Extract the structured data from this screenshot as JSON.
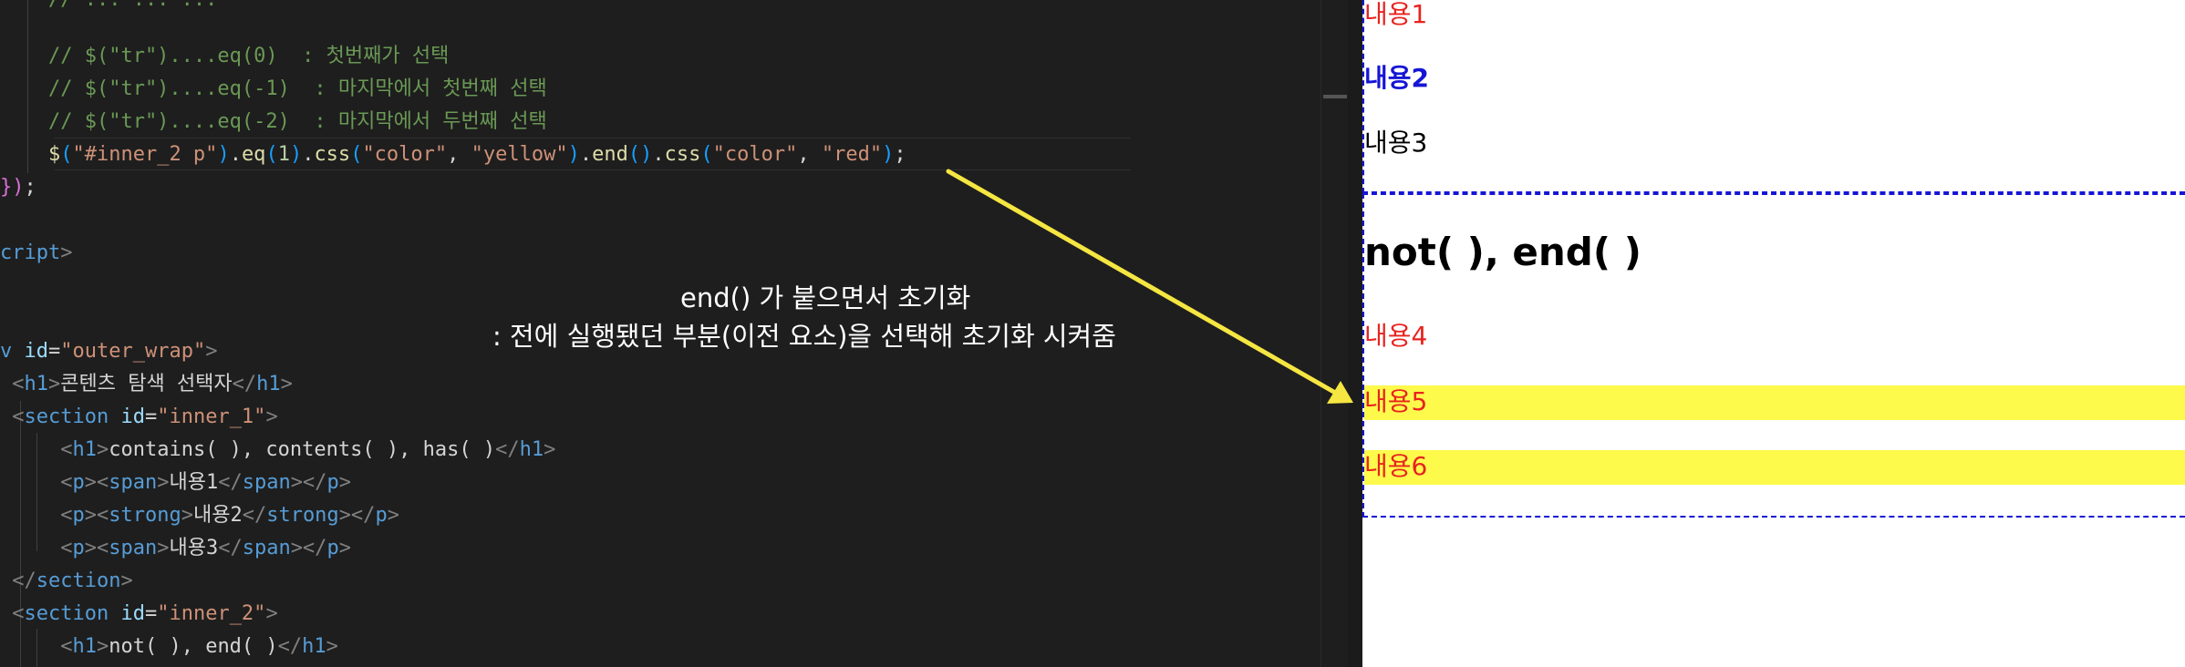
{
  "editor": {
    "lines": [
      {
        "segments": [
          {
            "t": "    // $(\"tr\")....eq(0)  : 첫번째가 선택",
            "c": "c-com"
          }
        ]
      },
      {
        "segments": [
          {
            "t": "    // $(\"tr\")....eq(-1)  : 마지막에서 첫번째 선택",
            "c": "c-com"
          }
        ]
      },
      {
        "segments": [
          {
            "t": "    // $(\"tr\")....eq(-2)  : 마지막에서 두번째 선택",
            "c": "c-com"
          }
        ]
      },
      {
        "segments": [
          {
            "t": "    $",
            "c": "c-fn"
          },
          {
            "t": "(",
            "c": "c-b2"
          },
          {
            "t": "\"#inner_2 p\"",
            "c": "c-str"
          },
          {
            "t": ")",
            "c": "c-b2"
          },
          {
            "t": ".",
            "c": "c-pun"
          },
          {
            "t": "eq",
            "c": "c-fn"
          },
          {
            "t": "(",
            "c": "c-b2"
          },
          {
            "t": "1",
            "c": "c-num"
          },
          {
            "t": ")",
            "c": "c-b2"
          },
          {
            "t": ".",
            "c": "c-pun"
          },
          {
            "t": "css",
            "c": "c-fn"
          },
          {
            "t": "(",
            "c": "c-b2"
          },
          {
            "t": "\"color\"",
            "c": "c-str"
          },
          {
            "t": ", ",
            "c": "c-pun"
          },
          {
            "t": "\"yellow\"",
            "c": "c-str"
          },
          {
            "t": ")",
            "c": "c-b2"
          },
          {
            "t": ".",
            "c": "c-pun"
          },
          {
            "t": "end",
            "c": "c-fn"
          },
          {
            "t": "()",
            "c": "c-b2"
          },
          {
            "t": ".",
            "c": "c-pun"
          },
          {
            "t": "css",
            "c": "c-fn"
          },
          {
            "t": "(",
            "c": "c-b2"
          },
          {
            "t": "\"color\"",
            "c": "c-str"
          },
          {
            "t": ", ",
            "c": "c-pun"
          },
          {
            "t": "\"red\"",
            "c": "c-str"
          },
          {
            "t": ")",
            "c": "c-b2"
          },
          {
            "t": ";",
            "c": "c-pun"
          }
        ]
      },
      {
        "segments": [
          {
            "t": "})",
            "c": "c-b1"
          },
          {
            "t": ";",
            "c": "c-pun"
          }
        ]
      },
      {
        "segments": []
      },
      {
        "segments": [
          {
            "t": "cript",
            "c": "c-tag"
          },
          {
            "t": ">",
            "c": "c-ang"
          }
        ]
      },
      {
        "segments": []
      },
      {
        "segments": []
      },
      {
        "segments": [
          {
            "t": "v ",
            "c": "c-tag"
          },
          {
            "t": "id",
            "c": "c-attr"
          },
          {
            "t": "=",
            "c": "c-pun"
          },
          {
            "t": "\"outer_wrap\"",
            "c": "c-str"
          },
          {
            "t": ">",
            "c": "c-ang"
          }
        ]
      },
      {
        "segments": [
          {
            "t": " <",
            "c": "c-ang"
          },
          {
            "t": "h1",
            "c": "c-tag"
          },
          {
            "t": ">",
            "c": "c-ang"
          },
          {
            "t": "콘텐츠 탐색 선택자",
            "c": "c-txt"
          },
          {
            "t": "</",
            "c": "c-ang"
          },
          {
            "t": "h1",
            "c": "c-tag"
          },
          {
            "t": ">",
            "c": "c-ang"
          }
        ]
      },
      {
        "segments": [
          {
            "t": " <",
            "c": "c-ang"
          },
          {
            "t": "section ",
            "c": "c-tag"
          },
          {
            "t": "id",
            "c": "c-attr"
          },
          {
            "t": "=",
            "c": "c-pun"
          },
          {
            "t": "\"inner_1\"",
            "c": "c-str"
          },
          {
            "t": ">",
            "c": "c-ang"
          }
        ]
      },
      {
        "segments": [
          {
            "t": "     <",
            "c": "c-ang"
          },
          {
            "t": "h1",
            "c": "c-tag"
          },
          {
            "t": ">",
            "c": "c-ang"
          },
          {
            "t": "contains( ), contents( ), has( )",
            "c": "c-txt"
          },
          {
            "t": "</",
            "c": "c-ang"
          },
          {
            "t": "h1",
            "c": "c-tag"
          },
          {
            "t": ">",
            "c": "c-ang"
          }
        ]
      },
      {
        "segments": [
          {
            "t": "     <",
            "c": "c-ang"
          },
          {
            "t": "p",
            "c": "c-tag"
          },
          {
            "t": "><",
            "c": "c-ang"
          },
          {
            "t": "span",
            "c": "c-tag"
          },
          {
            "t": ">",
            "c": "c-ang"
          },
          {
            "t": "내용1",
            "c": "c-txt"
          },
          {
            "t": "</",
            "c": "c-ang"
          },
          {
            "t": "span",
            "c": "c-tag"
          },
          {
            "t": "></",
            "c": "c-ang"
          },
          {
            "t": "p",
            "c": "c-tag"
          },
          {
            "t": ">",
            "c": "c-ang"
          }
        ]
      },
      {
        "segments": [
          {
            "t": "     <",
            "c": "c-ang"
          },
          {
            "t": "p",
            "c": "c-tag"
          },
          {
            "t": "><",
            "c": "c-ang"
          },
          {
            "t": "strong",
            "c": "c-tag"
          },
          {
            "t": ">",
            "c": "c-ang"
          },
          {
            "t": "내용2",
            "c": "c-txt"
          },
          {
            "t": "</",
            "c": "c-ang"
          },
          {
            "t": "strong",
            "c": "c-tag"
          },
          {
            "t": "></",
            "c": "c-ang"
          },
          {
            "t": "p",
            "c": "c-tag"
          },
          {
            "t": ">",
            "c": "c-ang"
          }
        ]
      },
      {
        "segments": [
          {
            "t": "     <",
            "c": "c-ang"
          },
          {
            "t": "p",
            "c": "c-tag"
          },
          {
            "t": "><",
            "c": "c-ang"
          },
          {
            "t": "span",
            "c": "c-tag"
          },
          {
            "t": ">",
            "c": "c-ang"
          },
          {
            "t": "내용3",
            "c": "c-txt"
          },
          {
            "t": "</",
            "c": "c-ang"
          },
          {
            "t": "span",
            "c": "c-tag"
          },
          {
            "t": "></",
            "c": "c-ang"
          },
          {
            "t": "p",
            "c": "c-tag"
          },
          {
            "t": ">",
            "c": "c-ang"
          }
        ]
      },
      {
        "segments": [
          {
            "t": " </",
            "c": "c-ang"
          },
          {
            "t": "section",
            "c": "c-tag"
          },
          {
            "t": ">",
            "c": "c-ang"
          }
        ]
      },
      {
        "segments": [
          {
            "t": " <",
            "c": "c-ang"
          },
          {
            "t": "section ",
            "c": "c-tag"
          },
          {
            "t": "id",
            "c": "c-attr"
          },
          {
            "t": "=",
            "c": "c-pun"
          },
          {
            "t": "\"inner_2\"",
            "c": "c-str"
          },
          {
            "t": ">",
            "c": "c-ang"
          }
        ]
      },
      {
        "segments": [
          {
            "t": "     <",
            "c": "c-ang"
          },
          {
            "t": "h1",
            "c": "c-tag"
          },
          {
            "t": ">",
            "c": "c-ang"
          },
          {
            "t": "not( ), end( )",
            "c": "c-txt"
          },
          {
            "t": "</",
            "c": "c-ang"
          },
          {
            "t": "h1",
            "c": "c-tag"
          },
          {
            "t": ">",
            "c": "c-ang"
          }
        ]
      }
    ]
  },
  "annotation": {
    "line1": "end() 가 붙으면서 초기화",
    "line2": ": 전에 실행됐던 부분(이전 요소)을 선택해  초기화 시켜줌",
    "arrow_color": "#f5e642"
  },
  "preview": {
    "item1": "내용1",
    "item2": "내용2",
    "item3": "내용3",
    "heading": "not( ), end( )",
    "item4": "내용4",
    "item5": "내용5",
    "item6": "내용6",
    "red": "#e8231f",
    "blue": "#1515d6",
    "highlight": "#fdfa4b"
  }
}
